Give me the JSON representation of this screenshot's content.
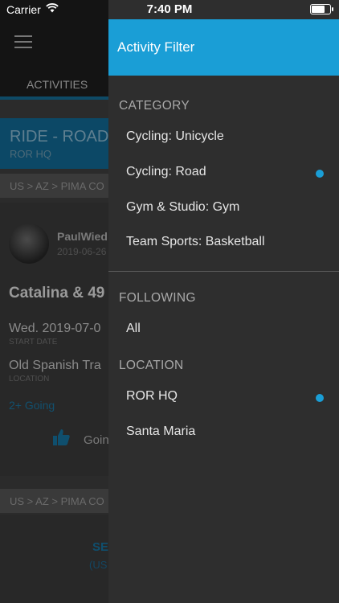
{
  "status_bar": {
    "carrier": "Carrier",
    "time": "7:40 PM"
  },
  "background": {
    "tab_label": "ACTIVITIES",
    "ride_title": "RIDE - ROAD",
    "ride_subtitle": "ROR HQ",
    "breadcrumb_1": "US > AZ > PIMA CO",
    "user_name": "PaulWied",
    "user_date": "2019-06-26",
    "activity_title": "Catalina & 49",
    "start_value": "Wed. 2019-07-0",
    "start_label": "START DATE",
    "location_value": "Old Spanish Tra",
    "location_label": "LOCATION",
    "going_count": "2+ Going",
    "going_button": "Goin",
    "breadcrumb_2": "US > AZ > PIMA CO",
    "bottom_link": "SE",
    "bottom_sub": "(US"
  },
  "drawer": {
    "title": "Activity Filter",
    "category_header": "CATEGORY",
    "categories": [
      {
        "label": "Cycling: Unicycle",
        "selected": false
      },
      {
        "label": "Cycling: Road",
        "selected": true
      },
      {
        "label": "Gym & Studio: Gym",
        "selected": false
      },
      {
        "label": "Team Sports: Basketball",
        "selected": false
      }
    ],
    "following_header": "FOLLOWING",
    "following": [
      {
        "label": "All",
        "selected": false
      }
    ],
    "location_header": "LOCATION",
    "locations": [
      {
        "label": "ROR HQ",
        "selected": true
      },
      {
        "label": "Santa Maria",
        "selected": false
      }
    ]
  },
  "colors": {
    "accent": "#1a9ed6",
    "drawer_bg": "#2e2e2e"
  }
}
